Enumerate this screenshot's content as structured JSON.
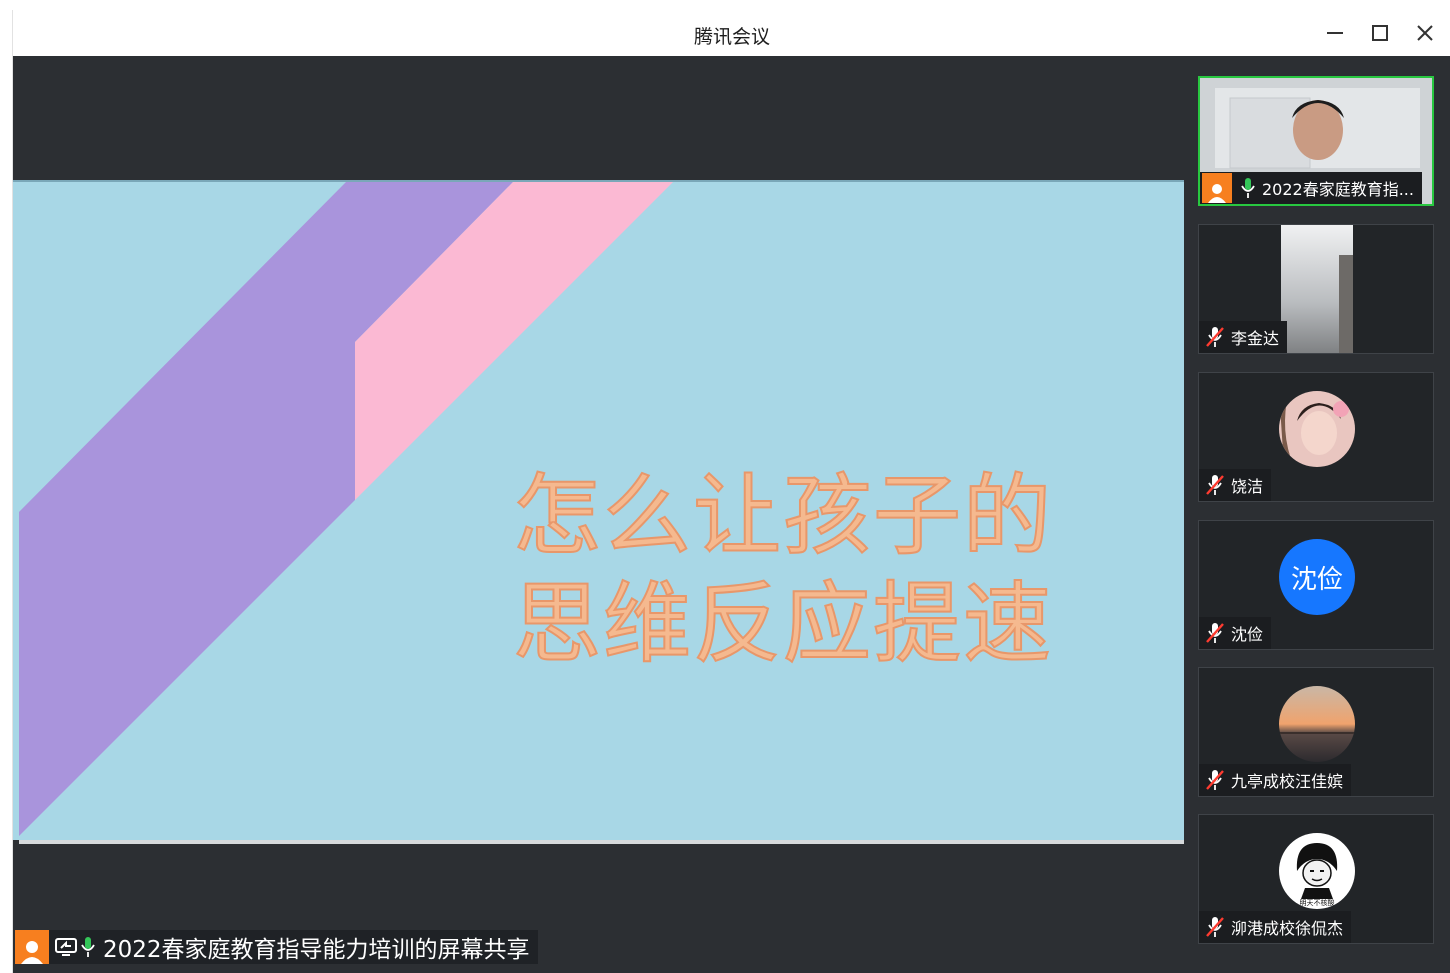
{
  "window": {
    "title": "腾讯会议",
    "controls": {
      "minimize": "minimize-icon",
      "maximize": "maximize-icon",
      "close": "close-icon"
    }
  },
  "slide": {
    "title_line1": "怎么让孩子的",
    "title_line2": "思维反应提速",
    "colors": {
      "background": "#a8d7e6",
      "stripe_purple": "#a994dc",
      "stripe_pink": "#fbb9d3",
      "text": "#f5b98f"
    }
  },
  "share_bar": {
    "label": "2022春家庭教育指导能力培训的屏幕共享",
    "icons": [
      "user-icon",
      "screen-share-icon",
      "mic-on-icon"
    ]
  },
  "participants": [
    {
      "name": "2022春家庭教育指...",
      "mic": "on",
      "video": "camera",
      "active": true
    },
    {
      "name": "李金达",
      "mic": "off",
      "video": "camera-strip"
    },
    {
      "name": "饶洁",
      "mic": "off",
      "video": "avatar-photo"
    },
    {
      "name": "沈俭",
      "mic": "off",
      "video": "initials",
      "initials": "沈俭",
      "initials_color": "#1677ff"
    },
    {
      "name": "九亭成校汪佳嫔",
      "mic": "off",
      "video": "avatar-sunset"
    },
    {
      "name": "泖港成校徐侃杰",
      "mic": "off",
      "video": "avatar-meme",
      "avatar_caption": "明天不核酸"
    }
  ]
}
